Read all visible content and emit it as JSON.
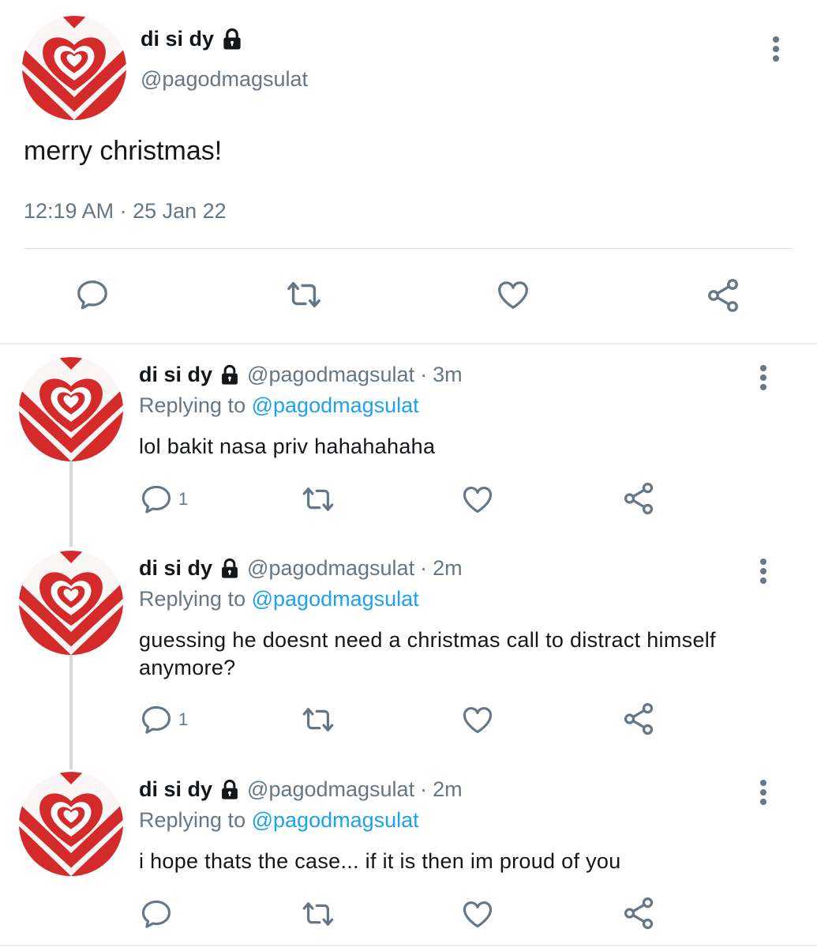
{
  "main_tweet": {
    "display_name": "di si dy",
    "handle": "@pagodmagsulat",
    "text": "merry christmas!",
    "meta": "12:19 AM · 25 Jan 22"
  },
  "replies": [
    {
      "display_name": "di si dy",
      "handle": "@pagodmagsulat",
      "separator": "·",
      "time": "3m",
      "replying_prefix": "Replying to",
      "replying_to": "@pagodmagsulat",
      "text": "lol bakit nasa priv hahahahaha",
      "reply_count": "1"
    },
    {
      "display_name": "di si dy",
      "handle": "@pagodmagsulat",
      "separator": "·",
      "time": "2m",
      "replying_prefix": "Replying to",
      "replying_to": "@pagodmagsulat",
      "text": "guessing he doesnt need a christmas call to distract himself anymore?",
      "reply_count": "1"
    },
    {
      "display_name": "di si dy",
      "handle": "@pagodmagsulat",
      "separator": "·",
      "time": "2m",
      "replying_prefix": "Replying to",
      "replying_to": "@pagodmagsulat",
      "text": "i hope thats the case... if it is then im proud of you",
      "reply_count": ""
    }
  ],
  "colors": {
    "accent": "#1da1f2",
    "secondary_text": "#657786",
    "avatar_red": "#d42a2a"
  },
  "icons": {
    "avatar": "heart-avatar-icon",
    "lock": "lock-icon",
    "more": "more-vertical-icon",
    "reply": "reply-bubble-icon",
    "retweet": "retweet-icon",
    "like": "heart-outline-icon",
    "share": "share-icon"
  }
}
